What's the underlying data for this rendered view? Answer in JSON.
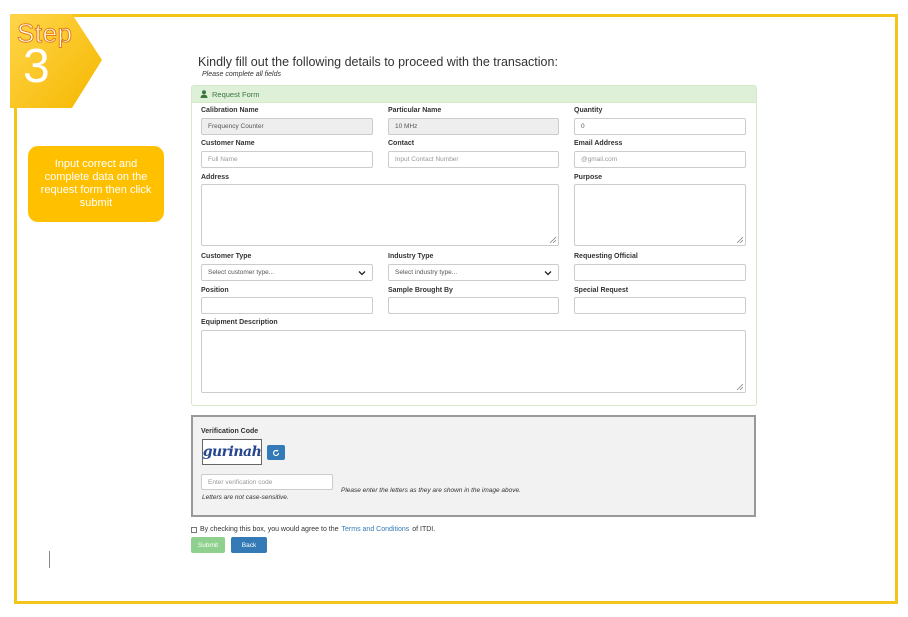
{
  "tutorial": {
    "step_word": "Step",
    "step_number": "3",
    "callout": "Input correct and complete data on the request form then click submit"
  },
  "page": {
    "heading": "Kindly fill out the following details to proceed with the transaction:",
    "subheading": "Please complete all fields"
  },
  "form": {
    "panel_title": "Request Form",
    "fields": {
      "calibration_name": {
        "label": "Calibration Name",
        "value": "Frequency Counter"
      },
      "particular_name": {
        "label": "Particular Name",
        "value": "10 MHz"
      },
      "quantity": {
        "label": "Quantity",
        "value": "0"
      },
      "customer_name": {
        "label": "Customer Name",
        "placeholder": "Full Name"
      },
      "contact": {
        "label": "Contact",
        "placeholder": "Input Contact Number"
      },
      "email": {
        "label": "Email Address",
        "placeholder": "@gmail.com"
      },
      "address": {
        "label": "Address"
      },
      "purpose": {
        "label": "Purpose"
      },
      "customer_type": {
        "label": "Customer Type",
        "selected": "Select customer type..."
      },
      "industry_type": {
        "label": "Industry Type",
        "selected": "Select industry type..."
      },
      "requesting_official": {
        "label": "Requesting Official"
      },
      "position": {
        "label": "Position"
      },
      "sample_brought_by": {
        "label": "Sample Brought By"
      },
      "special_request": {
        "label": "Special Request"
      },
      "equipment_description": {
        "label": "Equipment Description"
      }
    }
  },
  "verification": {
    "label": "Verification Code",
    "captcha_text": "gurinah",
    "input_placeholder": "Enter verification code",
    "case_note": "Letters are not case-sensitive.",
    "instruction": "Please enter the letters as they are shown in the image above."
  },
  "agreement": {
    "prefix": "By checking this box, you would agree to the",
    "link": "Terms and Conditions",
    "suffix": "of ITDI."
  },
  "buttons": {
    "submit": "Submit",
    "back": "Back"
  },
  "colors": {
    "frame": "#f3c51a",
    "callout": "#ffc000",
    "panel_header": "#dff0d8",
    "submit": "#8fd08f",
    "back": "#337ab7"
  }
}
